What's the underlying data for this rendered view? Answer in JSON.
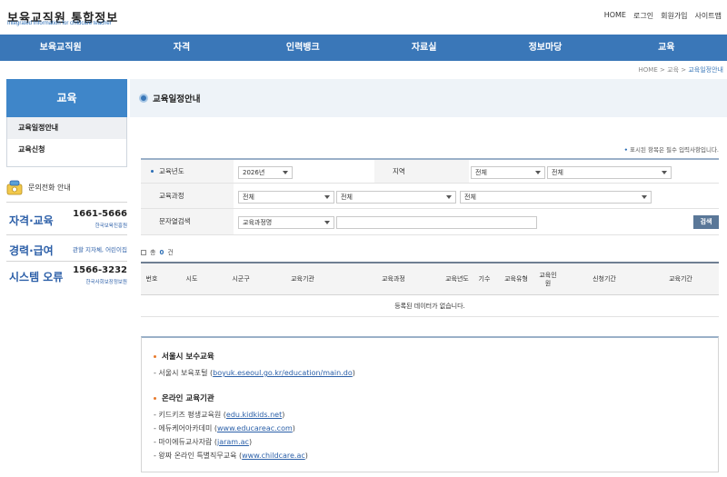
{
  "header": {
    "logo_main": "보육교직원 통합정보",
    "logo_sub": "Integrated Information for childcare teacher",
    "util": [
      "HOME",
      "로그인",
      "회원가입",
      "사이트맵"
    ]
  },
  "gnb": [
    "보육교직원",
    "자격",
    "인력뱅크",
    "자료실",
    "정보마당",
    "교육"
  ],
  "breadcrumb": {
    "home": "HOME",
    "sep1": ">",
    "mid": "교육",
    "sep2": ">",
    "current": "교육일정안내"
  },
  "sidebar": {
    "title": "교육",
    "items": [
      {
        "label": "교육일정안내",
        "active": true
      },
      {
        "label": "교육신청",
        "active": false
      }
    ],
    "contact_title": "문의전화 안내",
    "contacts": [
      {
        "label": "자격·교육",
        "number": "1661-5666",
        "org": "한국보육진흥원"
      },
      {
        "label": "경력·급여",
        "number": "",
        "org": "관할 지자체, 어린이집"
      },
      {
        "label": "시스템 오류",
        "number": "1566-3232",
        "org": "한국사회보장정보원"
      }
    ]
  },
  "page": {
    "title": "교육일정안내",
    "required_note_mark": "•",
    "required_note": "표시된 항목은 필수 입력사항입니다."
  },
  "form": {
    "year_label": "교육년도",
    "year_value": "2026년",
    "region_label": "지역",
    "region_1": "전체",
    "region_2": "전체",
    "course_label": "교육과정",
    "course_1": "전체",
    "course_2": "전체",
    "course_3": "전체",
    "text_label": "문자열검색",
    "text_type": "교육과정명",
    "text_value": "",
    "search_button": "검색"
  },
  "list": {
    "total_prefix": "총",
    "total_count": "0",
    "total_suffix": "건",
    "columns": [
      "번호",
      "시도",
      "시군구",
      "교육기관",
      "교육과정",
      "교육년도",
      "기수",
      "교육유형",
      "교육인원",
      "신청기간",
      "교육기간"
    ],
    "empty_message": "등록된 데이터가 없습니다."
  },
  "info": {
    "sec1_title": "서울시 보수교육",
    "sec1_lines": [
      {
        "prefix": "- 서울시 보육포털 (",
        "link": "boyuk.eseoul.go.kr/education/main.do",
        "suffix": ")"
      }
    ],
    "sec2_title": "온라인 교육기관",
    "sec2_lines": [
      {
        "prefix": "- 키드키즈 평생교육원 (",
        "link": "edu.kidkids.net",
        "suffix": ")"
      },
      {
        "prefix": "- 에듀케어아카데미 (",
        "link": "www.educareac.com",
        "suffix": ")"
      },
      {
        "prefix": "- 마이에듀교사자람 (",
        "link": "jaram.ac",
        "suffix": ")"
      },
      {
        "prefix": "- 왕짜 온라인 특별직무교육 (",
        "link": "www.childcare.ac",
        "suffix": ")"
      }
    ]
  },
  "colors": {
    "brand": "#3a77b8",
    "accent": "#2c5fa8"
  }
}
